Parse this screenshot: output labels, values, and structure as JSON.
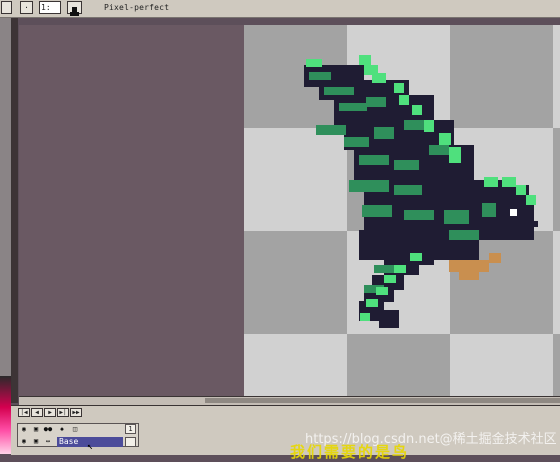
{
  "toolbar": {
    "zoom_value": "1:",
    "pixel_perfect_label": "Pixel-perfect"
  },
  "timeline": {
    "play_controls": [
      "first-frame",
      "previous-frame",
      "play",
      "next-frame",
      "last-frame"
    ],
    "frame_number": "1",
    "layer_name": "Base"
  },
  "overlay": {
    "watermark": "https://blog.csdn.net@稀土掘金技术社区",
    "caption_partial": "我们需要的是鸟"
  },
  "colors": {
    "canvas_bg": "#6a5963",
    "checker_dark": "#a3a3a3",
    "checker_light": "#d1d1d1",
    "bird_outline": "#1f1c33",
    "bird_green": "#2f8f5b",
    "bird_light_green": "#4fe07d",
    "bird_beak": "#c98f4f"
  }
}
